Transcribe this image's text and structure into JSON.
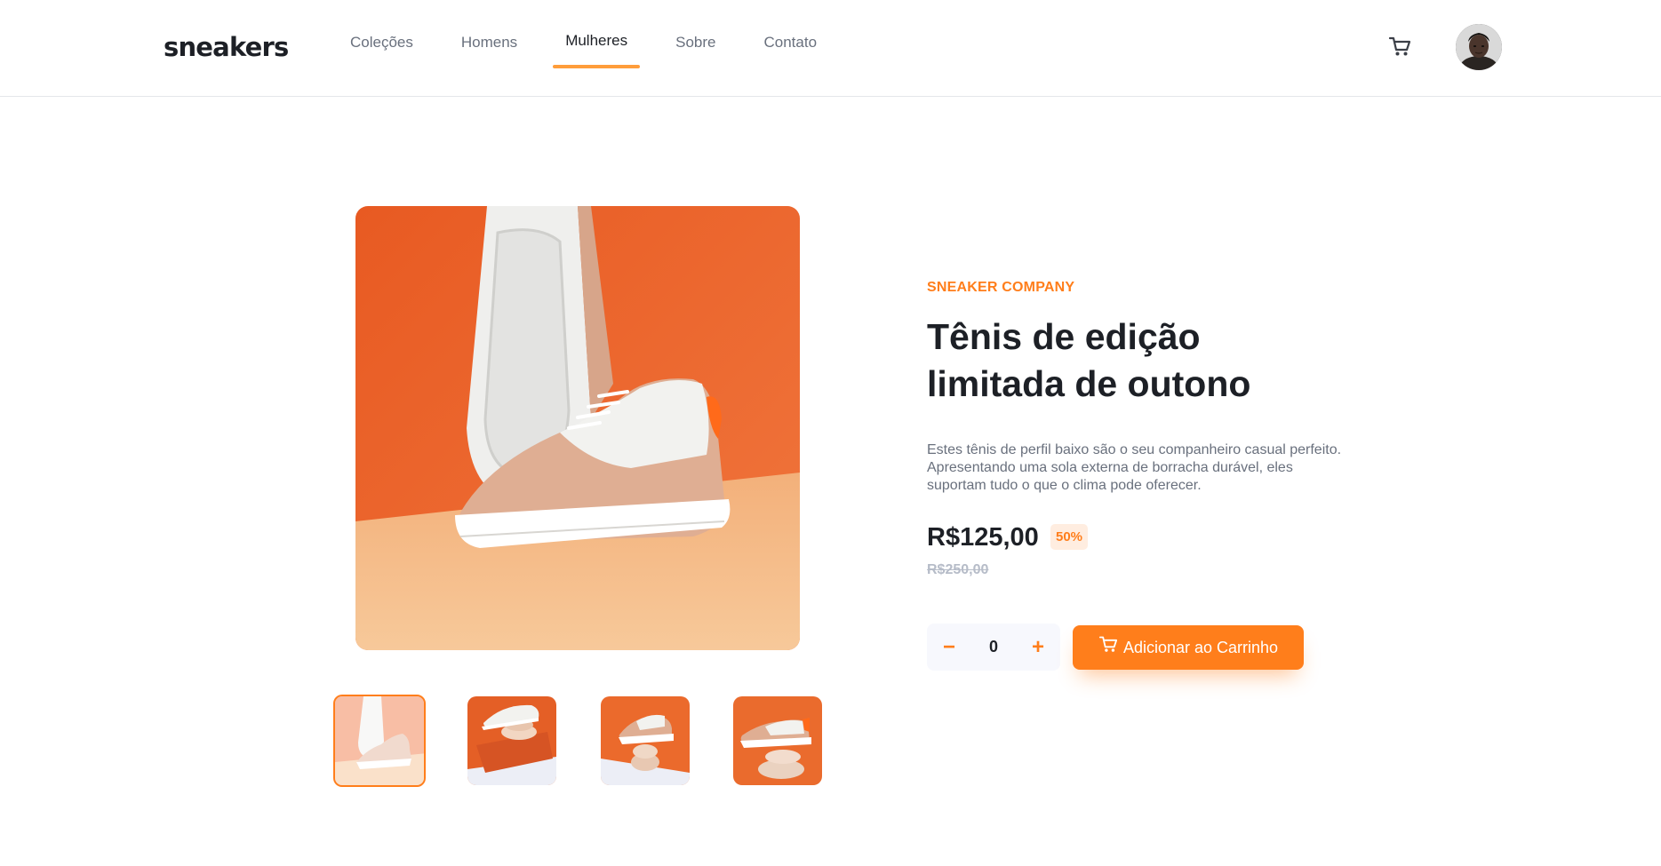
{
  "header": {
    "logo": "sneakers",
    "nav": [
      {
        "label": "Coleções",
        "active": false
      },
      {
        "label": "Homens",
        "active": false
      },
      {
        "label": "Mulheres",
        "active": true
      },
      {
        "label": "Sobre",
        "active": false
      },
      {
        "label": "Contato",
        "active": false
      }
    ],
    "cart_icon": "cart-icon",
    "avatar_icon": "user-avatar"
  },
  "gallery": {
    "main_image": "sneaker-main-photo",
    "thumbnails": [
      {
        "name": "thumbnail-1",
        "active": true
      },
      {
        "name": "thumbnail-2",
        "active": false
      },
      {
        "name": "thumbnail-3",
        "active": false
      },
      {
        "name": "thumbnail-4",
        "active": false
      }
    ]
  },
  "product": {
    "company": "SNEAKER COMPANY",
    "title_line1": "Tênis de edição",
    "title_line2": "limitada de outono",
    "description": "Estes tênis de perfil baixo são o seu companheiro casual perfeito. Apresentando uma sola externa de borracha durável, eles suportam tudo o que o clima pode oferecer.",
    "price": "R$125,00",
    "discount": "50%",
    "old_price": "R$250,00"
  },
  "cart_controls": {
    "minus": "−",
    "quantity": "0",
    "plus": "+",
    "add_label": "Adicionar ao Carrinho"
  },
  "colors": {
    "accent": "#ff7e1b",
    "accent_pale": "#ffede0",
    "text_dark": "#1d2026",
    "text_muted": "#69707d",
    "text_light": "#b6bcc8"
  }
}
